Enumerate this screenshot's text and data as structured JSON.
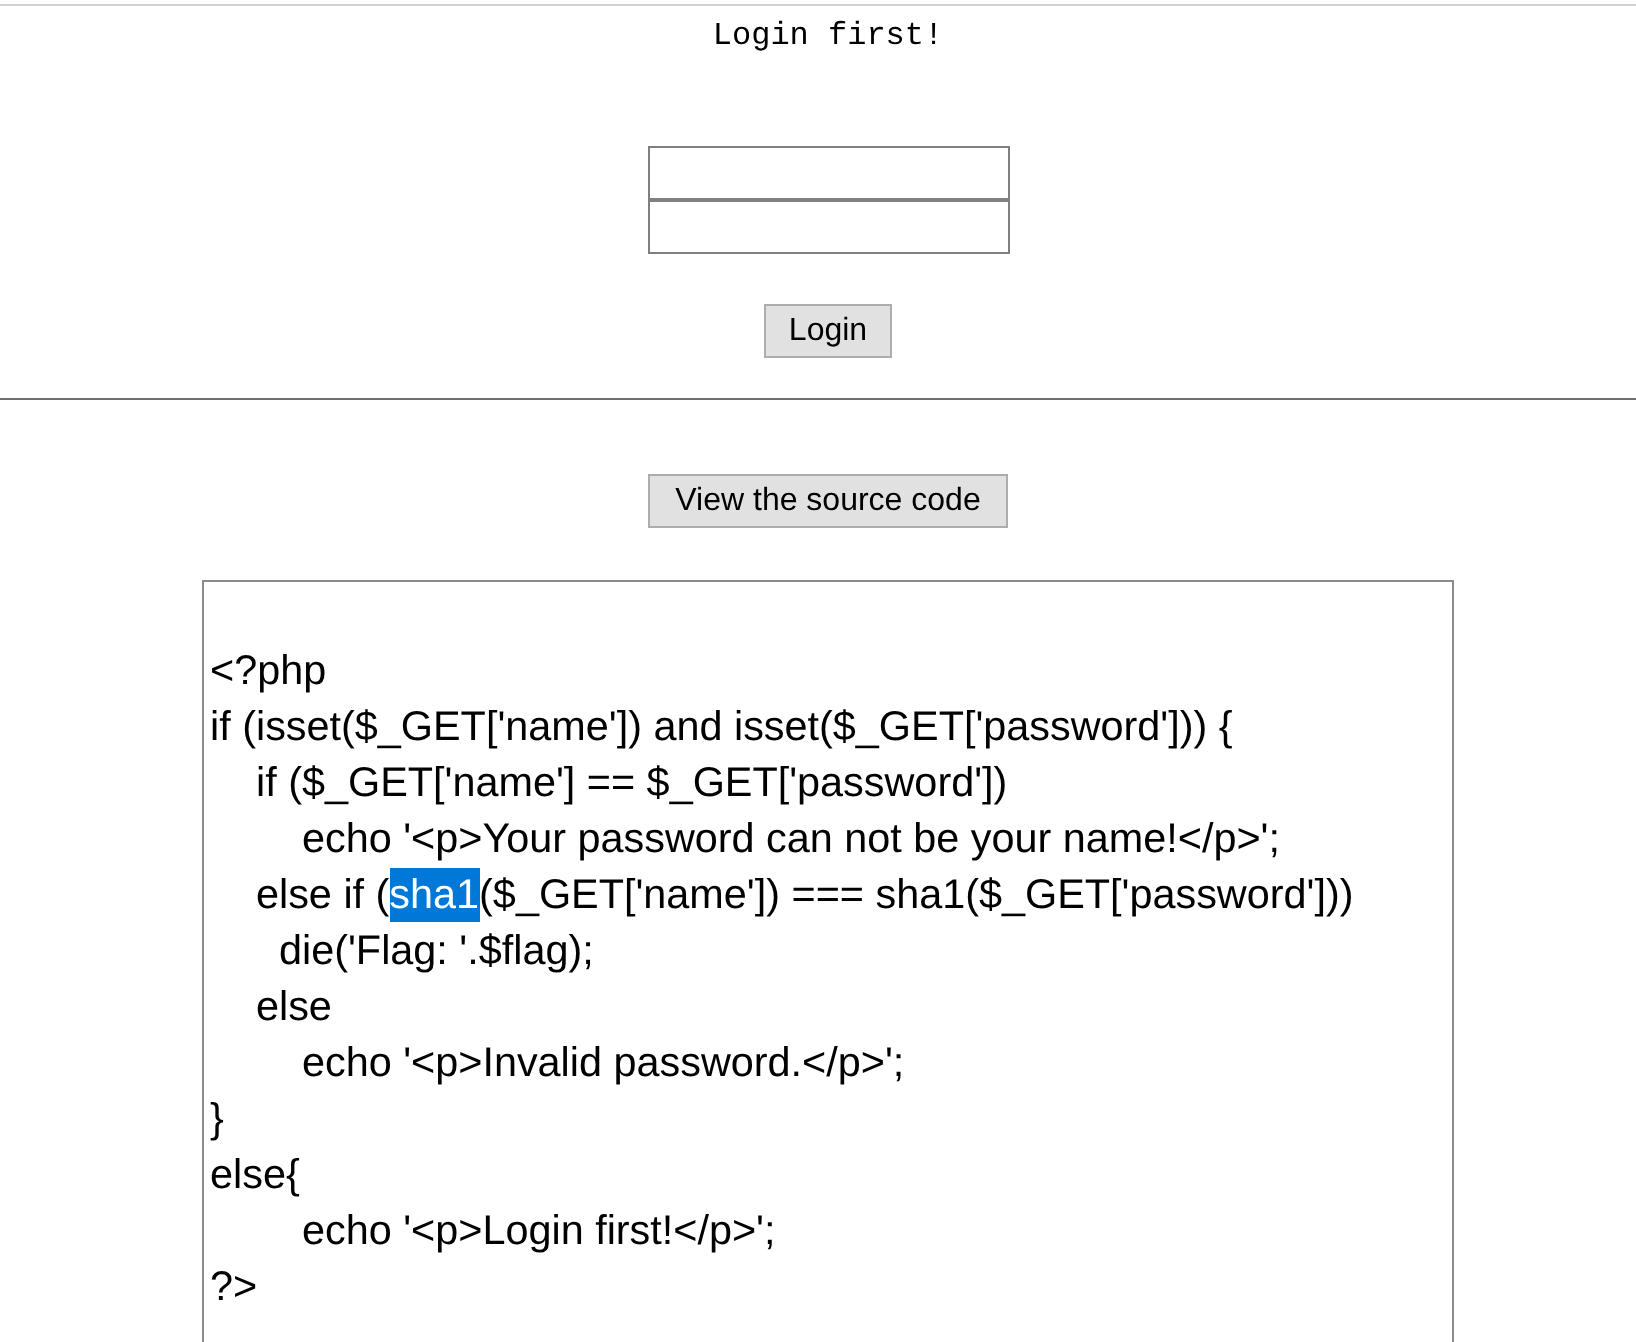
{
  "message": "Login first!",
  "login_form": {
    "fields": [
      {
        "focused": false
      },
      {
        "focused": false
      }
    ],
    "submit_label": "Login"
  },
  "source_button": "View the source code",
  "source_code": {
    "lines": [
      {
        "parts": [
          {
            "text": "<?php",
            "selected": false
          }
        ]
      },
      {
        "parts": [
          {
            "text": "if (isset($_GET['name']) and isset($_GET['password'])) {",
            "selected": false
          }
        ]
      },
      {
        "parts": [
          {
            "text": "    if ($_GET['name'] == $_GET['password'])",
            "selected": false
          }
        ]
      },
      {
        "parts": [
          {
            "text": "        echo '<p>Your password can not be your name!</p>';",
            "selected": false
          }
        ]
      },
      {
        "parts": [
          {
            "text": "    else if (",
            "selected": false
          },
          {
            "text": "sha1",
            "selected": true
          },
          {
            "text": "($_GET['name']) === sha1($_GET['password']))",
            "selected": false
          }
        ]
      },
      {
        "parts": [
          {
            "text": "      die('Flag: '.$flag);",
            "selected": false
          }
        ]
      },
      {
        "parts": [
          {
            "text": "    else",
            "selected": false
          }
        ]
      },
      {
        "parts": [
          {
            "text": "        echo '<p>Invalid password.</p>';",
            "selected": false
          }
        ]
      },
      {
        "parts": [
          {
            "text": "}",
            "selected": false
          }
        ]
      },
      {
        "parts": [
          {
            "text": "else{",
            "selected": false
          }
        ]
      },
      {
        "parts": [
          {
            "text": "        echo '<p>Login first!</p>';",
            "selected": false
          }
        ]
      },
      {
        "parts": [
          {
            "text": "?>",
            "selected": false
          }
        ]
      }
    ]
  }
}
